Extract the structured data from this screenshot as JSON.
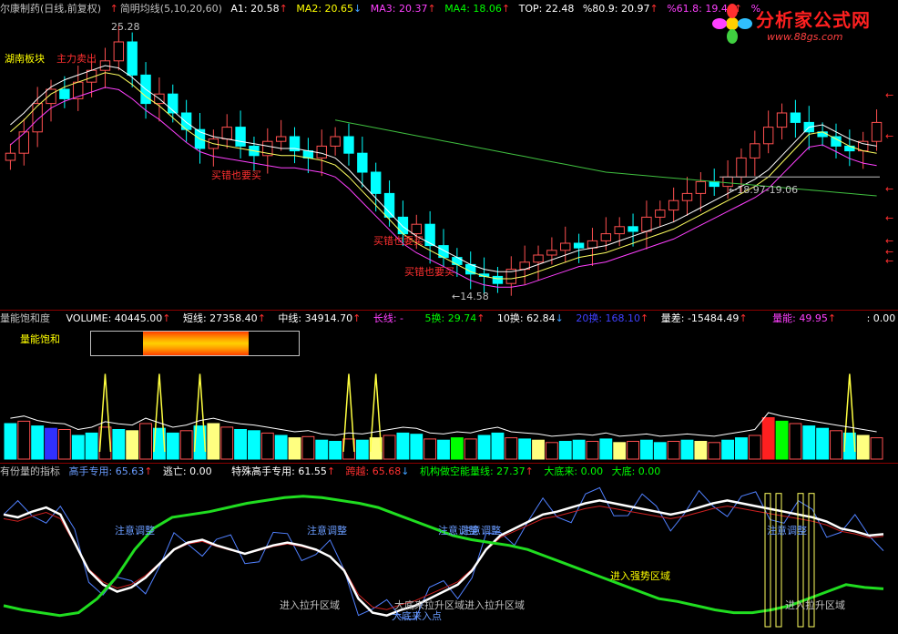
{
  "main_pane": {
    "stock_name": "尔康制药(日线,前复权)",
    "indicator_name": "简明均线(5,10,20,60)",
    "a1": "A1: 20.58",
    "ma2": "MA2: 20.65",
    "ma3": "MA3: 20.37",
    "ma4": "MA4: 18.06",
    "top": "TOP: 22.48",
    "pct809": "%80.9: 20.97",
    "pct618": "%61.8: 19.46",
    "pct_tail": "%",
    "high_label": "25.28",
    "low_label": "←14.58",
    "range_label": "←18.97-19.06",
    "sector_label": "湖南板块",
    "sell_label": "主力卖出",
    "buy_labels": [
      "买错也要买",
      "买错也要买",
      "买错也要买"
    ]
  },
  "volume_pane": {
    "title": "量能饱和度",
    "volume": "VOLUME: 40445.00",
    "short": "短线: 27358.40",
    "mid": "中线: 34914.70",
    "long": "长线: -",
    "h5": "5换: 29.74",
    "h10": "10换: 62.84",
    "h20": "20换: 168.10",
    "diff": "量差: -15484.49",
    "energy": "量能: 49.95",
    "tail": ": 0.00",
    "saturation_label": "量能饱和",
    "saturation_start": 0.25,
    "saturation_end": 0.76
  },
  "osc_pane": {
    "title": "有份量的指标",
    "expert": "高手专用: 65.63",
    "escape": "逃亡: 0.00",
    "special": "特殊高手专用: 61.55",
    "cross": "跨越: 65.68",
    "inst": "机构做空能量线: 27.37",
    "bottom_come": "大底来: 0.00",
    "bottom": "大底: 0.00",
    "annotations": [
      "注意调整",
      "注意调整",
      "注意调整",
      "注意调整",
      "注意调整",
      "进入拉升区域",
      "大底来拉升区域进入拉升区域",
      "进入强势区域",
      "进入拉升区域",
      "大底来入点"
    ]
  },
  "logo": {
    "main": "分析家公式网",
    "url": "www.88gs.com"
  },
  "chart_data": [
    {
      "type": "candlestick",
      "title": "尔康制药(日线,前复权)",
      "series": [
        {
          "name": "A1",
          "values": [
            21.5,
            22.0,
            22.6,
            23.1,
            23.4,
            23.6,
            23.8,
            24.0,
            23.9,
            23.5,
            23.0,
            22.6,
            22.1,
            21.6,
            21.2,
            21.0,
            20.9,
            20.8,
            20.7,
            20.6,
            20.5,
            20.5,
            20.4,
            20.3,
            20.1,
            19.6,
            19.0,
            18.4,
            17.8,
            17.2,
            16.8,
            16.5,
            16.2,
            15.9,
            15.6,
            15.4,
            15.3,
            15.3,
            15.4,
            15.6,
            15.8,
            16.0,
            16.2,
            16.3,
            16.4,
            16.6,
            16.8,
            17.0,
            17.2,
            17.4,
            17.7,
            18.0,
            18.3,
            18.6,
            18.9,
            19.2,
            19.6,
            20.2,
            20.8,
            21.4,
            21.5,
            21.2,
            20.9,
            20.7,
            20.6
          ]
        },
        {
          "name": "MA2"
        },
        {
          "name": "MA3"
        },
        {
          "name": "MA4"
        }
      ],
      "candles_close": [
        20.3,
        21.2,
        22.4,
        23.0,
        22.6,
        23.3,
        23.8,
        24.2,
        25.0,
        23.6,
        22.4,
        22.8,
        22.0,
        21.3,
        20.5,
        20.9,
        21.4,
        20.6,
        20.2,
        20.8,
        21.0,
        20.4,
        20.1,
        20.6,
        21.0,
        20.3,
        19.5,
        18.6,
        17.6,
        16.9,
        17.3,
        16.4,
        15.9,
        15.6,
        15.2,
        15.1,
        14.8,
        15.4,
        15.7,
        16.0,
        16.2,
        16.5,
        16.3,
        16.6,
        16.9,
        17.2,
        17.0,
        17.6,
        17.9,
        18.3,
        18.6,
        19.1,
        18.9,
        19.3,
        20.1,
        20.7,
        21.4,
        22.0,
        21.6,
        21.2,
        21.0,
        20.6,
        20.4,
        20.8,
        21.6
      ],
      "high": 25.28,
      "low": 14.58,
      "ylim": [
        14.0,
        26.0
      ]
    },
    {
      "type": "bar",
      "title": "量能饱和度",
      "values": [
        30,
        32,
        28,
        26,
        25,
        20,
        22,
        27,
        25,
        24,
        30,
        26,
        22,
        24,
        28,
        30,
        27,
        25,
        24,
        22,
        20,
        18,
        19,
        16,
        15,
        17,
        16,
        18,
        20,
        22,
        21,
        17,
        16,
        18,
        17,
        20,
        22,
        18,
        17,
        16,
        14,
        15,
        16,
        15,
        17,
        14,
        15,
        16,
        14,
        15,
        16,
        15,
        14,
        16,
        18,
        20,
        35,
        32,
        30,
        28,
        26,
        24,
        22,
        20,
        18
      ],
      "spikes": [
        7,
        11,
        14,
        25,
        27,
        62
      ],
      "ylim": [
        0,
        80
      ]
    },
    {
      "type": "line",
      "title": "有份量的指标",
      "series": [
        {
          "name": "高手专用",
          "values": [
            80,
            78,
            82,
            85,
            80,
            60,
            40,
            30,
            25,
            28,
            35,
            45,
            55,
            60,
            62,
            58,
            55,
            52,
            55,
            58,
            60,
            58,
            55,
            50,
            40,
            20,
            10,
            8,
            12,
            15,
            20,
            25,
            30,
            40,
            55,
            65,
            70,
            75,
            80,
            82,
            85,
            88,
            90,
            88,
            86,
            84,
            82,
            80,
            82,
            85,
            88,
            90,
            88,
            86,
            84,
            82,
            80,
            78,
            75,
            70,
            68,
            65,
            66
          ]
        },
        {
          "name": "机构做空能量线",
          "values": [
            15,
            12,
            10,
            8,
            10,
            20,
            35,
            55,
            70,
            78,
            80,
            82,
            85,
            88,
            90,
            92,
            93,
            92,
            90,
            88,
            85,
            80,
            75,
            70,
            65,
            62,
            60,
            58,
            55,
            50,
            45,
            40,
            35,
            30,
            25,
            20,
            18,
            15,
            12,
            10,
            10,
            12,
            15,
            20,
            25,
            30,
            28,
            27
          ]
        }
      ],
      "ylim": [
        0,
        100
      ]
    }
  ]
}
